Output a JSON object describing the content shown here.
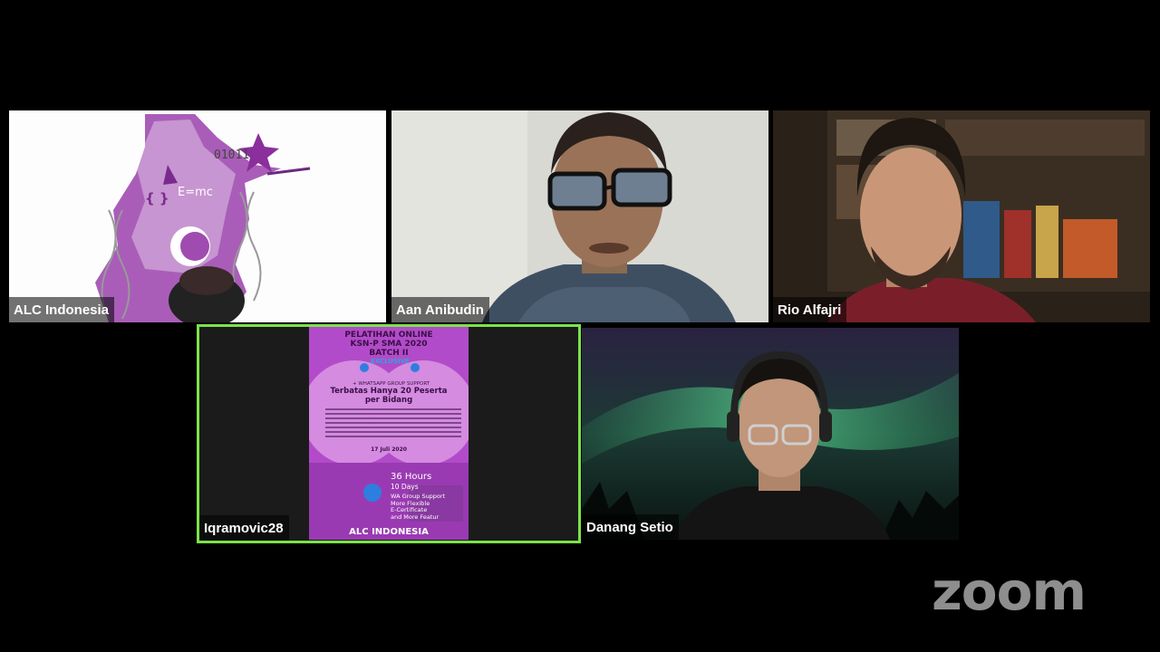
{
  "participants": [
    {
      "name": "ALC Indonesia"
    },
    {
      "name": "Aan Anibudin"
    },
    {
      "name": "Rio Alfajri"
    },
    {
      "name": "Iqramovic28"
    },
    {
      "name": "Danang Setio"
    }
  ],
  "tile1_art": {
    "binary": "01011",
    "formula": "E=mc"
  },
  "poster": {
    "title_line1": "PELATIHAN ONLINE",
    "title_line2": "KSN-P SMA 2020",
    "title_line3": "BATCH II",
    "exclusive": "EXCLUSIVE",
    "support": "+ WHATSAPP GROUP SUPPORT",
    "limit_line1": "Terbatas Hanya 20 Peserta",
    "limit_line2": "per Bidang",
    "date": "17 Juli 2020",
    "hours": "36 Hours",
    "days": "10 Days",
    "features": [
      "WA Group Support",
      "More Flexible",
      "E-Certificate",
      "and More Featur"
    ],
    "brand": "ALC INDONESIA"
  },
  "logo": {
    "text": "zoom"
  },
  "colors": {
    "active_speaker_border": "#7be34a",
    "poster_bg": "#b24bc9"
  }
}
